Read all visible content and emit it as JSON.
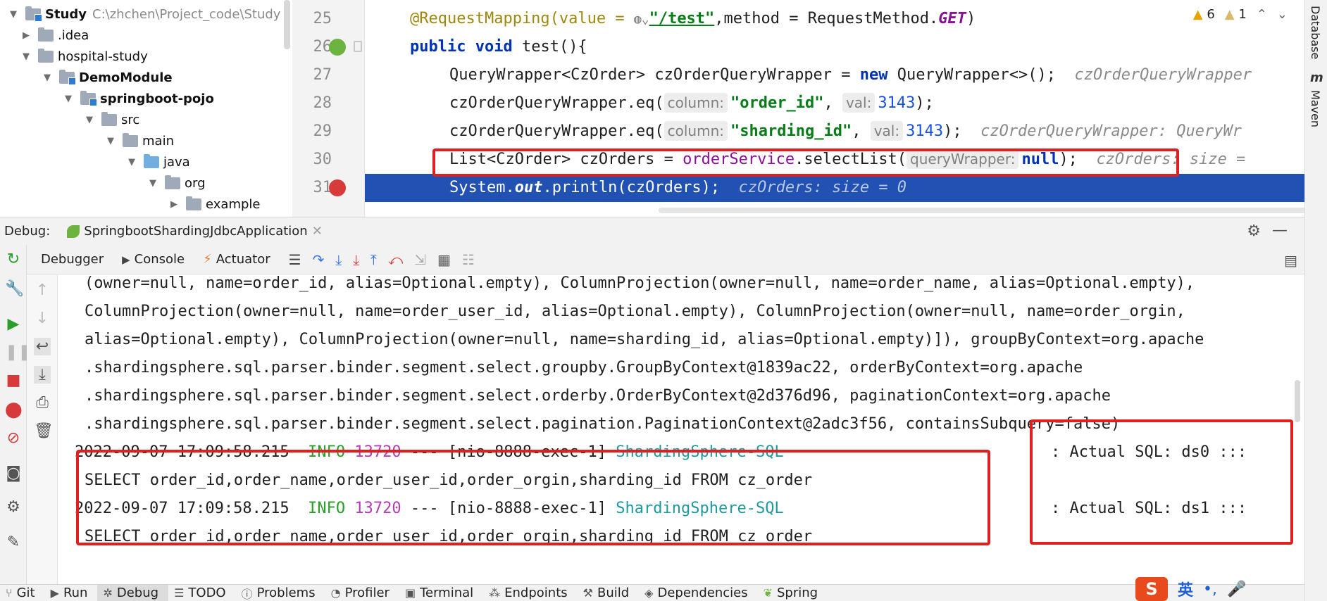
{
  "project_tree": {
    "items": [
      {
        "label": "Study",
        "path": "C:\\zhchen\\Project_code\\Study"
      },
      {
        "label": ".idea"
      },
      {
        "label": "hospital-study"
      },
      {
        "label": "DemoModule"
      },
      {
        "label": "springboot-pojo"
      },
      {
        "label": "src"
      },
      {
        "label": "main"
      },
      {
        "label": "java"
      },
      {
        "label": "org"
      },
      {
        "label": "example"
      }
    ]
  },
  "editor": {
    "warnings": {
      "yellow": "6",
      "weak": "1"
    },
    "lines": [
      {
        "num": "25",
        "text": "@RequestMapping(value = ",
        "url": "\"/test\"",
        "rest": ",method = RequestMethod.",
        "get": "GET",
        "end": ")"
      },
      {
        "num": "26",
        "kw1": "public",
        "kw2": "void",
        "text": " test(){"
      },
      {
        "num": "27",
        "text": "QueryWrapper<CzOrder> czOrderQueryWrapper = ",
        "kw": "new",
        "rest": " QueryWrapper<>();",
        "inline": "czOrderQueryWrapper"
      },
      {
        "num": "28",
        "text": "czOrderQueryWrapper.eq(",
        "hint1": "column:",
        "str1": "\"order_id\"",
        "hint2": "val:",
        "num1": "3143",
        "end": ");"
      },
      {
        "num": "29",
        "text": "czOrderQueryWrapper.eq(",
        "hint1": "column:",
        "str1": "\"sharding_id\"",
        "hint2": "val:",
        "num1": "3143",
        "end": ");",
        "inline": "czOrderQueryWrapper: QueryWr"
      },
      {
        "num": "30",
        "text": "List<CzOrder> czOrders = ",
        "field": "orderService",
        "rest": ".selectList(",
        "hint1": "queryWrapper:",
        "kw": "null",
        "end": ");",
        "inline": "czOrders:  size ="
      },
      {
        "num": "31",
        "text": "System.",
        "out": "out",
        "rest": ".println(czOrders);",
        "inline": "czOrders:  size = 0"
      }
    ]
  },
  "right_strip": {
    "database": "Database",
    "maven": "Maven",
    "m_icon": "m"
  },
  "debug": {
    "label": "Debug:",
    "tab": "SpringbootShardingJdbcApplication",
    "toolbar": {
      "debugger": "Debugger",
      "console": "Console",
      "actuator": "Actuator"
    }
  },
  "console": {
    "wrapped_lines": [
      "(owner=null, name=order_id, alias=Optional.empty), ColumnProjection(owner=null, name=order_name, alias=Optional.empty),",
      "ColumnProjection(owner=null, name=order_user_id, alias=Optional.empty), ColumnProjection(owner=null, name=order_orgin,",
      "alias=Optional.empty), ColumnProjection(owner=null, name=sharding_id, alias=Optional.empty)]), groupByContext=org.apache",
      ".shardingsphere.sql.parser.binder.segment.select.groupby.GroupByContext@1839ac22, orderByContext=org.apache",
      ".shardingsphere.sql.parser.binder.segment.select.orderby.OrderByContext@2d376d96, paginationContext=org.apache",
      ".shardingsphere.sql.parser.binder.segment.select.pagination.PaginationContext@2adc3f56, containsSubquery=false)"
    ],
    "logs": [
      {
        "timestamp": "2022-09-07 17:09:58.215",
        "level": "INFO",
        "pid": "13720",
        "thread": "--- [nio-8888-exec-1]",
        "logger": "ShardingSphere-SQL",
        "message": ": Actual SQL: ds0 :::",
        "sql": "SELECT  order_id,order_name,order_user_id,order_orgin,sharding_id  FROM cz_order"
      },
      {
        "timestamp": "2022-09-07 17:09:58.215",
        "level": "INFO",
        "pid": "13720",
        "thread": "--- [nio-8888-exec-1]",
        "logger": "ShardingSphere-SQL",
        "message": ": Actual SQL: ds1 :::",
        "sql": "SELECT  order_id,order_name,order_user_id,order_orgin,sharding_id  FROM cz_order"
      }
    ]
  },
  "bottom_bar": {
    "items": [
      "Git",
      "Run",
      "Debug",
      "TODO",
      "Problems",
      "Profiler",
      "Terminal",
      "Endpoints",
      "Build",
      "Dependencies",
      "Spring"
    ],
    "ime": {
      "logo": "S",
      "lang": "英"
    }
  },
  "colors": {
    "highlight": "#2251b4",
    "red_box": "#e02020",
    "spring": "#6db33f"
  }
}
